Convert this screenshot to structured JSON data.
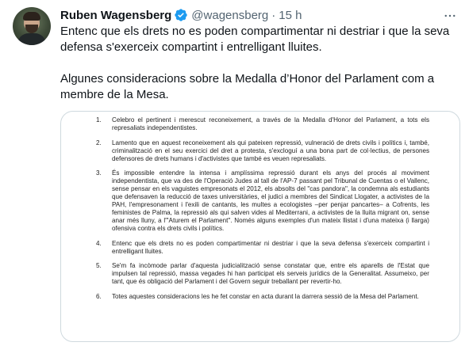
{
  "author": {
    "name": "Ruben Wagensberg",
    "handle": "@wagensberg",
    "separator": "·",
    "time": "15 h"
  },
  "icons": {
    "verified": "verified-badge-icon",
    "more": "more-options-icon"
  },
  "colors": {
    "verified": "#1d9bf0",
    "text": "#0f1419",
    "secondary": "#536471",
    "border": "#cfd9de"
  },
  "tweet": {
    "paragraph1": "Entenc que els drets no es poden compartimentar ni destriar i que la seva defensa s'exerceix compartint i entrelligant lluites.",
    "paragraph2": "Algunes consideracions sobre la Medalla d’Honor del Parlament com a membre de la Mesa."
  },
  "document": {
    "items": [
      {
        "num": "1.",
        "text": "Celebro el pertinent i merescut reconeixement, a través de la Medalla d'Honor del Parlament, a tots els represaliats independentistes."
      },
      {
        "num": "2.",
        "text": "Lamento que en aquest reconeixement als qui pateixen repressió, vulneració de drets civils i polítics i, també, criminalització en el seu exercici del dret a protesta, s'excloguí a una bona part de col·lectius, de persones defensores de drets humans i d'activistes que també es veuen represaliats."
      },
      {
        "num": "3.",
        "text": "És impossible entendre la intensa i amplíssima repressió durant els anys del procés al moviment independentista, que va des de l'Operació Judes al tall de l'AP-7 passant pel Tribunal de Cuentas o el Vallenc, sense pensar en els vaguistes empresonats el 2012, els absolts del \"cas pandora\", la condemna als estudiants que defensaven la reducció de taxes universitàries, el judici a membres del Sindicat Llogater, a activistes de la PAH, l'empresonament i l'exili de cantants, les multes a ecologistes –per penjar pancartes– a Cofrents, les feministes de Palma, la repressió als qui salven vides al Mediterrani, a activistes de la lluita migrant on, sense anar més lluny, a l'\"Aturem el Parlament\". Només alguns exemples d'un mateix llistat i d'una mateixa (i llarga) ofensiva contra els drets civils i polítics."
      },
      {
        "num": "4.",
        "text": "Entenc que els drets no es poden compartimentar ni destriar i que la seva defensa s'exerceix compartint i entrelligant lluites."
      },
      {
        "num": "5.",
        "text": "Se'm fa incòmode parlar d'aquesta judicialització sense constatar que, entre els aparells de l'Estat que impulsen tal repressió, massa vegades hi han participat els serveis jurídics de la Generalitat. Assumeixo, per tant, que és obligació del Parlament i del Govern seguir treballant per revertir-ho."
      },
      {
        "num": "6.",
        "text": "Totes aquestes consideracions les he fet constar en acta durant la darrera sessió de la Mesa del Parlament."
      }
    ]
  }
}
